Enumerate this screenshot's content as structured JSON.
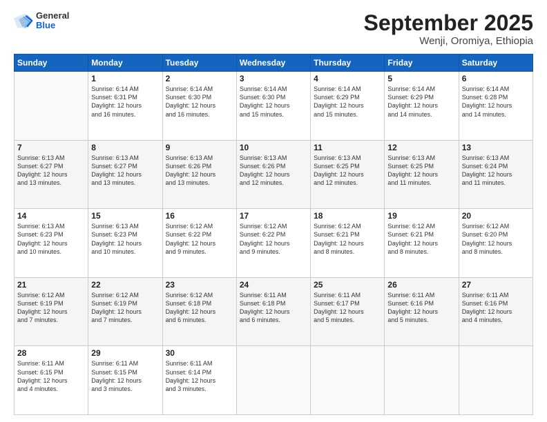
{
  "logo": {
    "general": "General",
    "blue": "Blue"
  },
  "header": {
    "month": "September 2025",
    "location": "Wenji, Oromiya, Ethiopia"
  },
  "days_of_week": [
    "Sunday",
    "Monday",
    "Tuesday",
    "Wednesday",
    "Thursday",
    "Friday",
    "Saturday"
  ],
  "weeks": [
    [
      {
        "day": "",
        "info": ""
      },
      {
        "day": "1",
        "info": "Sunrise: 6:14 AM\nSunset: 6:31 PM\nDaylight: 12 hours\nand 16 minutes."
      },
      {
        "day": "2",
        "info": "Sunrise: 6:14 AM\nSunset: 6:30 PM\nDaylight: 12 hours\nand 16 minutes."
      },
      {
        "day": "3",
        "info": "Sunrise: 6:14 AM\nSunset: 6:30 PM\nDaylight: 12 hours\nand 15 minutes."
      },
      {
        "day": "4",
        "info": "Sunrise: 6:14 AM\nSunset: 6:29 PM\nDaylight: 12 hours\nand 15 minutes."
      },
      {
        "day": "5",
        "info": "Sunrise: 6:14 AM\nSunset: 6:29 PM\nDaylight: 12 hours\nand 14 minutes."
      },
      {
        "day": "6",
        "info": "Sunrise: 6:14 AM\nSunset: 6:28 PM\nDaylight: 12 hours\nand 14 minutes."
      }
    ],
    [
      {
        "day": "7",
        "info": "Sunrise: 6:13 AM\nSunset: 6:27 PM\nDaylight: 12 hours\nand 13 minutes."
      },
      {
        "day": "8",
        "info": "Sunrise: 6:13 AM\nSunset: 6:27 PM\nDaylight: 12 hours\nand 13 minutes."
      },
      {
        "day": "9",
        "info": "Sunrise: 6:13 AM\nSunset: 6:26 PM\nDaylight: 12 hours\nand 13 minutes."
      },
      {
        "day": "10",
        "info": "Sunrise: 6:13 AM\nSunset: 6:26 PM\nDaylight: 12 hours\nand 12 minutes."
      },
      {
        "day": "11",
        "info": "Sunrise: 6:13 AM\nSunset: 6:25 PM\nDaylight: 12 hours\nand 12 minutes."
      },
      {
        "day": "12",
        "info": "Sunrise: 6:13 AM\nSunset: 6:25 PM\nDaylight: 12 hours\nand 11 minutes."
      },
      {
        "day": "13",
        "info": "Sunrise: 6:13 AM\nSunset: 6:24 PM\nDaylight: 12 hours\nand 11 minutes."
      }
    ],
    [
      {
        "day": "14",
        "info": "Sunrise: 6:13 AM\nSunset: 6:23 PM\nDaylight: 12 hours\nand 10 minutes."
      },
      {
        "day": "15",
        "info": "Sunrise: 6:13 AM\nSunset: 6:23 PM\nDaylight: 12 hours\nand 10 minutes."
      },
      {
        "day": "16",
        "info": "Sunrise: 6:12 AM\nSunset: 6:22 PM\nDaylight: 12 hours\nand 9 minutes."
      },
      {
        "day": "17",
        "info": "Sunrise: 6:12 AM\nSunset: 6:22 PM\nDaylight: 12 hours\nand 9 minutes."
      },
      {
        "day": "18",
        "info": "Sunrise: 6:12 AM\nSunset: 6:21 PM\nDaylight: 12 hours\nand 8 minutes."
      },
      {
        "day": "19",
        "info": "Sunrise: 6:12 AM\nSunset: 6:21 PM\nDaylight: 12 hours\nand 8 minutes."
      },
      {
        "day": "20",
        "info": "Sunrise: 6:12 AM\nSunset: 6:20 PM\nDaylight: 12 hours\nand 8 minutes."
      }
    ],
    [
      {
        "day": "21",
        "info": "Sunrise: 6:12 AM\nSunset: 6:19 PM\nDaylight: 12 hours\nand 7 minutes."
      },
      {
        "day": "22",
        "info": "Sunrise: 6:12 AM\nSunset: 6:19 PM\nDaylight: 12 hours\nand 7 minutes."
      },
      {
        "day": "23",
        "info": "Sunrise: 6:12 AM\nSunset: 6:18 PM\nDaylight: 12 hours\nand 6 minutes."
      },
      {
        "day": "24",
        "info": "Sunrise: 6:11 AM\nSunset: 6:18 PM\nDaylight: 12 hours\nand 6 minutes."
      },
      {
        "day": "25",
        "info": "Sunrise: 6:11 AM\nSunset: 6:17 PM\nDaylight: 12 hours\nand 5 minutes."
      },
      {
        "day": "26",
        "info": "Sunrise: 6:11 AM\nSunset: 6:16 PM\nDaylight: 12 hours\nand 5 minutes."
      },
      {
        "day": "27",
        "info": "Sunrise: 6:11 AM\nSunset: 6:16 PM\nDaylight: 12 hours\nand 4 minutes."
      }
    ],
    [
      {
        "day": "28",
        "info": "Sunrise: 6:11 AM\nSunset: 6:15 PM\nDaylight: 12 hours\nand 4 minutes."
      },
      {
        "day": "29",
        "info": "Sunrise: 6:11 AM\nSunset: 6:15 PM\nDaylight: 12 hours\nand 3 minutes."
      },
      {
        "day": "30",
        "info": "Sunrise: 6:11 AM\nSunset: 6:14 PM\nDaylight: 12 hours\nand 3 minutes."
      },
      {
        "day": "",
        "info": ""
      },
      {
        "day": "",
        "info": ""
      },
      {
        "day": "",
        "info": ""
      },
      {
        "day": "",
        "info": ""
      }
    ]
  ]
}
